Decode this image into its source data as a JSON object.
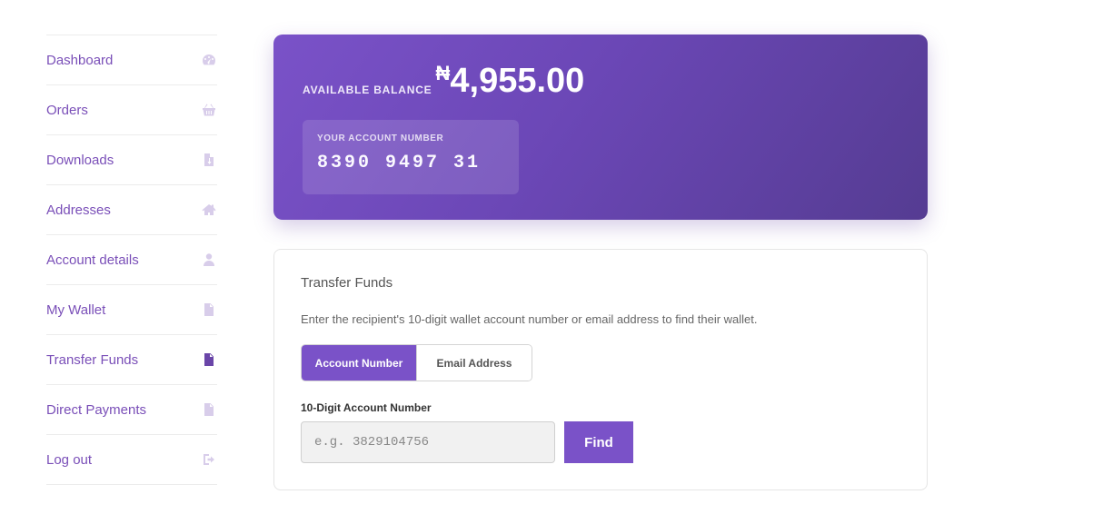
{
  "sidebar": {
    "items": [
      {
        "label": "Dashboard",
        "icon": "dashboard-gauge-icon"
      },
      {
        "label": "Orders",
        "icon": "basket-icon"
      },
      {
        "label": "Downloads",
        "icon": "file-download-icon"
      },
      {
        "label": "Addresses",
        "icon": "home-icon"
      },
      {
        "label": "Account details",
        "icon": "user-icon"
      },
      {
        "label": "My Wallet",
        "icon": "document-icon"
      },
      {
        "label": "Transfer Funds",
        "icon": "document-icon",
        "active": true
      },
      {
        "label": "Direct Payments",
        "icon": "document-icon"
      },
      {
        "label": "Log out",
        "icon": "sign-out-icon"
      }
    ]
  },
  "balance": {
    "label": "AVAILABLE BALANCE",
    "currency": "₦",
    "amount": "4,955.00",
    "account_label": "YOUR ACCOUNT NUMBER",
    "account_number": "8390 9497 31"
  },
  "transfer": {
    "title": "Transfer Funds",
    "description": "Enter the recipient's 10-digit wallet account number or email address to find their wallet.",
    "toggle": {
      "account_label": "Account Number",
      "email_label": "Email Address",
      "selected": "Account Number"
    },
    "field_label": "10-Digit Account Number",
    "input_placeholder": "e.g. 3829104756",
    "input_value": "",
    "find_label": "Find"
  },
  "colors": {
    "accent": "#7a52c8",
    "nav_text": "#7a4fb8",
    "nav_icon": "#d8cdea",
    "nav_icon_active": "#6a45a8"
  }
}
